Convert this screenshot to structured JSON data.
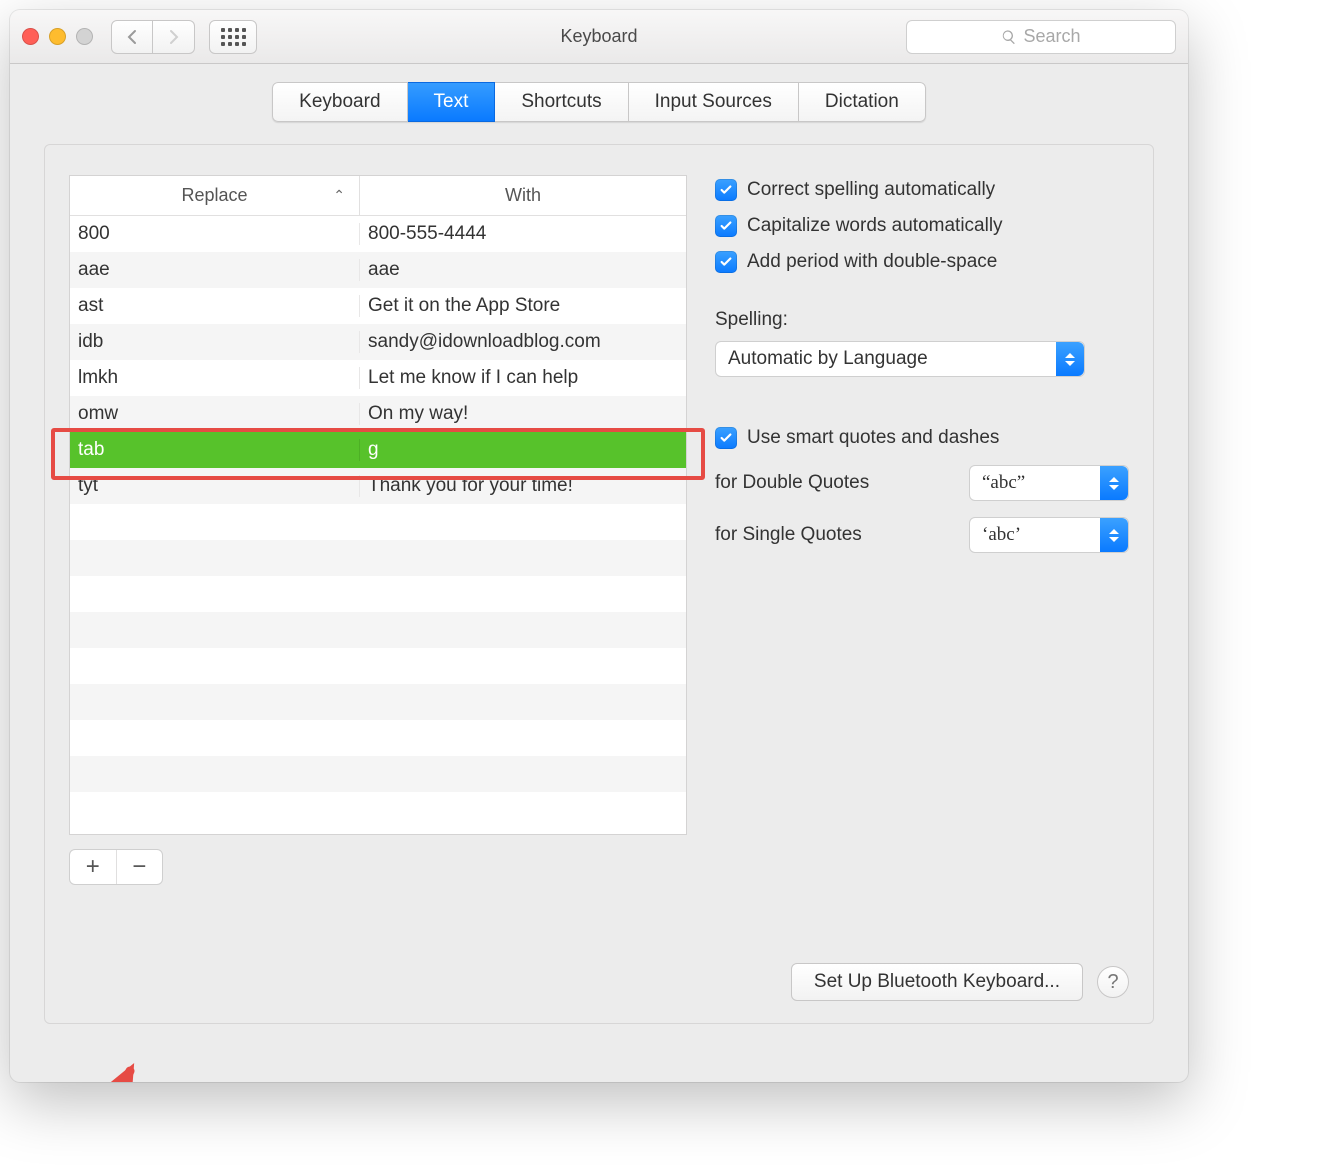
{
  "window_title": "Keyboard",
  "search_placeholder": "Search",
  "tabs": [
    "Keyboard",
    "Text",
    "Shortcuts",
    "Input Sources",
    "Dictation"
  ],
  "active_tab_index": 1,
  "table": {
    "col1": "Replace",
    "col2": "With",
    "rows": [
      {
        "replace": "800",
        "with": "800-555-4444"
      },
      {
        "replace": "aae",
        "with": "aae"
      },
      {
        "replace": "ast",
        "with": "Get it on the App Store"
      },
      {
        "replace": "idb",
        "with": "sandy@idownloadblog.com"
      },
      {
        "replace": "lmkh",
        "with": "Let me know if I can help"
      },
      {
        "replace": "omw",
        "with": "On my way!"
      },
      {
        "replace": "tab",
        "with": "g"
      },
      {
        "replace": "tyt",
        "with": "Thank you for your time!"
      }
    ],
    "selected_index": 6
  },
  "checks": {
    "correct_spelling": "Correct spelling automatically",
    "capitalize": "Capitalize words automatically",
    "add_period": "Add period with double-space",
    "smart_quotes": "Use smart quotes and dashes"
  },
  "spelling_label": "Spelling:",
  "spelling_value": "Automatic by Language",
  "double_quotes_label": "for Double Quotes",
  "double_quotes_value": "“abc”",
  "single_quotes_label": "for Single Quotes",
  "single_quotes_value": "‘abc’",
  "bluetooth_button": "Set Up Bluetooth Keyboard...",
  "add_label": "+",
  "remove_label": "−"
}
